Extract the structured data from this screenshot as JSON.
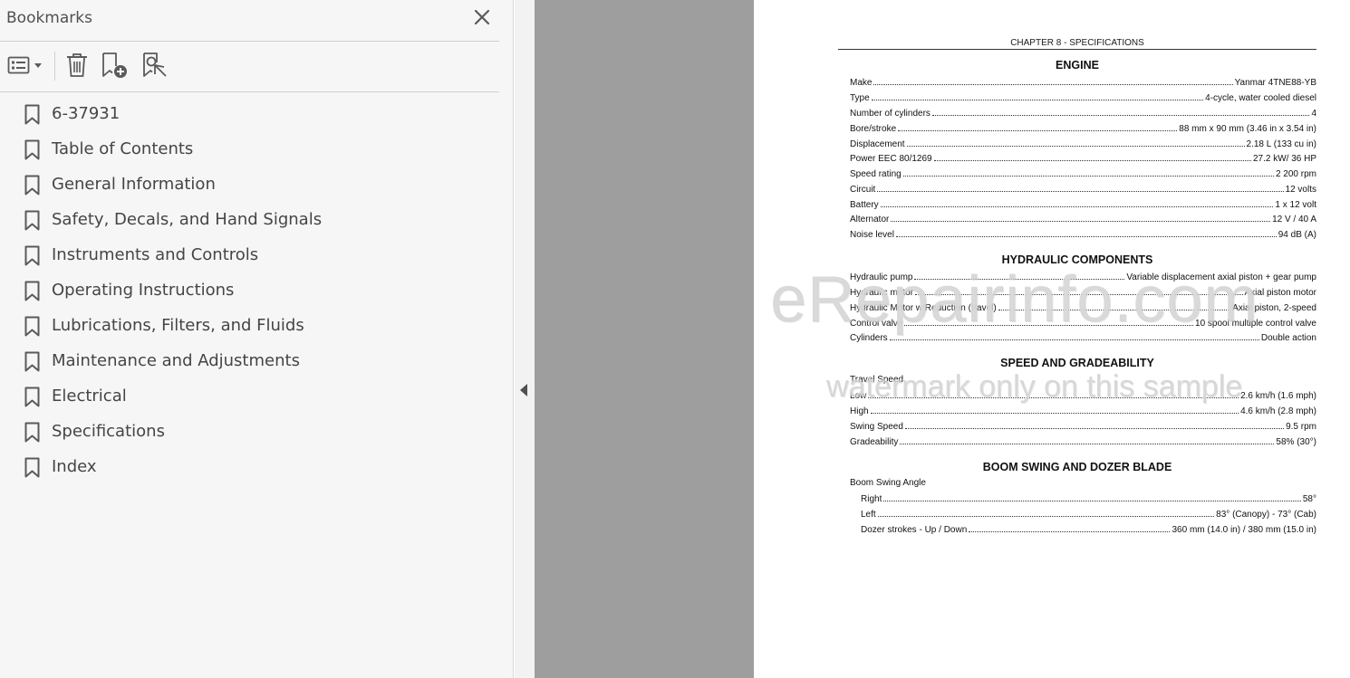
{
  "bookmarks_panel": {
    "title": "Bookmarks",
    "items": [
      {
        "label": "6-37931"
      },
      {
        "label": "Table of Contents"
      },
      {
        "label": "General Information"
      },
      {
        "label": "Safety, Decals, and Hand Signals"
      },
      {
        "label": "Instruments and Controls"
      },
      {
        "label": "Operating Instructions"
      },
      {
        "label": "Lubrications, Filters, and Fluids"
      },
      {
        "label": "Maintenance and Adjustments"
      },
      {
        "label": "Electrical"
      },
      {
        "label": "Specifications"
      },
      {
        "label": "Index"
      }
    ]
  },
  "document": {
    "chapter_title": "CHAPTER 8 - SPECIFICATIONS",
    "engine": {
      "heading": "ENGINE",
      "rows": [
        {
          "label": "Make",
          "value": "Yanmar 4TNE88-YB"
        },
        {
          "label": "Type",
          "value": "4-cycle, water cooled diesel"
        },
        {
          "label": "Number of cylinders",
          "value": "4"
        },
        {
          "label": "Bore/stroke",
          "value": "88 mm x 90 mm (3.46 in x 3.54 in)"
        },
        {
          "label": "Displacement",
          "value": "2.18 L (133 cu in)"
        },
        {
          "label": "Power EEC 80/1269",
          "value": "27.2 kW/ 36 HP"
        },
        {
          "label": "Speed rating",
          "value": "2 200 rpm"
        },
        {
          "label": "Circuit",
          "value": "12 volts"
        },
        {
          "label": "Battery",
          "value": "1 x 12 volt"
        },
        {
          "label": "Alternator",
          "value": "12 V / 40 A"
        },
        {
          "label": "Noise level",
          "value": "94 dB (A)"
        }
      ]
    },
    "hydraulic": {
      "heading": "HYDRAULIC COMPONENTS",
      "rows": [
        {
          "label": "Hydraulic pump",
          "value": "Variable displacement axial piston + gear pump"
        },
        {
          "label": "Hydraulic motor",
          "value": "Axial piston motor"
        },
        {
          "label": "Hydraulic Motor w/Reduction (travel)",
          "value": "Axial piston, 2-speed"
        },
        {
          "label": "Control valve",
          "value": "10 spool multiple control valve"
        },
        {
          "label": "Cylinders",
          "value": "Double action"
        }
      ]
    },
    "speed": {
      "heading": "SPEED AND GRADEABILITY",
      "subheading": "Travel Speed",
      "rows": [
        {
          "label": "Low",
          "value": "2.6 km/h (1.6 mph)"
        },
        {
          "label": "High",
          "value": "4.6 km/h (2.8 mph)"
        },
        {
          "label": "Swing Speed",
          "value": "9.5 rpm"
        },
        {
          "label": "Gradeability",
          "value": "58% (30°)"
        }
      ]
    },
    "boom": {
      "heading": "BOOM SWING AND DOZER BLADE",
      "subheading": "Boom Swing Angle",
      "rows": [
        {
          "label": "Right",
          "value": "58°"
        },
        {
          "label": "Left",
          "value": "83° (Canopy) - 73° (Cab)"
        },
        {
          "label": "Dozer strokes - Up / Down",
          "value": "360 mm (14.0 in) / 380 mm (15.0 in)"
        }
      ]
    },
    "watermark_line1": "eRepairinfo.com",
    "watermark_line2": "watermark only on this sample"
  },
  "icons": {
    "close": "close-icon",
    "options": "bookmark-options-icon",
    "delete": "trash-icon",
    "new_bookmark": "add-bookmark-icon",
    "find_bookmark": "find-bookmark-icon",
    "bookmark": "bookmark-icon",
    "collapse": "collapse-arrow-icon"
  },
  "colors": {
    "panel_bg": "#f6f6f6",
    "gray_area": "#9e9e9e",
    "icon": "#5a5a5a"
  }
}
